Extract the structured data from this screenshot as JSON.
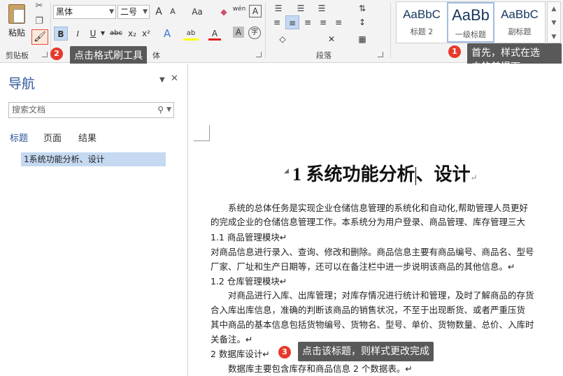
{
  "ribbon": {
    "paste_label": "粘贴",
    "clipboard_group": "剪贴板",
    "font_group_tail": "体",
    "paragraph_group": "段落",
    "font_name": "黑体",
    "font_size": "二号",
    "grow_label": "A",
    "shrink_label": "A",
    "case_label": "Aa",
    "phonetic_label": "wén",
    "border_char_label": "A",
    "bold_label": "B",
    "italic_label": "I",
    "underline_label": "U",
    "strike_label": "abc",
    "sub_label": "x₂",
    "sup_label": "x²",
    "effect_label": "A",
    "highlight_label": "ab",
    "fontcolor_label": "A",
    "shading_label": "A",
    "enclose_label": "字",
    "styles": [
      {
        "preview": "AaBbC",
        "name": "标题 2"
      },
      {
        "preview": "AaBb",
        "name": "一级标题"
      },
      {
        "preview": "AaBbC",
        "name": "副标题"
      }
    ]
  },
  "callouts": {
    "c1_num": "1",
    "c1_line1": "首先，样式在选",
    "c1_line2": "中的前提下",
    "c2_num": "2",
    "c2_text": "点击格式刷工具",
    "c3_num": "3",
    "c3_text": "点击该标题，则样式更改完成"
  },
  "nav": {
    "title": "导航",
    "search_placeholder": "搜索文档",
    "tabs": [
      "标题",
      "页面",
      "结果"
    ],
    "items": [
      "1系统功能分析、设计"
    ]
  },
  "doc": {
    "heading_a": "1 系统功能分析",
    "heading_b": "、设计",
    "lines": [
      "　　系统的总体任务是实现企业仓储信息管理的系统化和自动化,帮助管理人员更好",
      "的完成企业的仓储信息管理工作。本系统分为用户登录、商品管理、库存管理三大",
      "1.1 商品管理模块↵",
      "对商品信息进行录入、查询、修改和删除。商品信息主要有商品编号、商品名、型号",
      "厂家、厂址和生产日期等，还可以在备注栏中进一步说明该商品的其他信息。↵",
      "1.2 仓库管理模块↵",
      "　　对商品进行入库、出库管理；对库存情况进行统计和管理，及时了解商品的存货",
      "合入库出库信息，准确的判断该商品的销售状况，不至于出现断货、或者严重压货",
      "其中商品的基本信息包括货物编号、货物名、型号、单价、货物数量、总价、入库时",
      "关备注。↵",
      "2 数据库设计↵",
      "　　数据库主要包含库存和商品信息 2 个数据表。↵"
    ]
  },
  "colors": {
    "accent": "#2b579a",
    "callout_bg": "#595959",
    "badge": "#e8392b",
    "selection": "#c5d9f1"
  }
}
